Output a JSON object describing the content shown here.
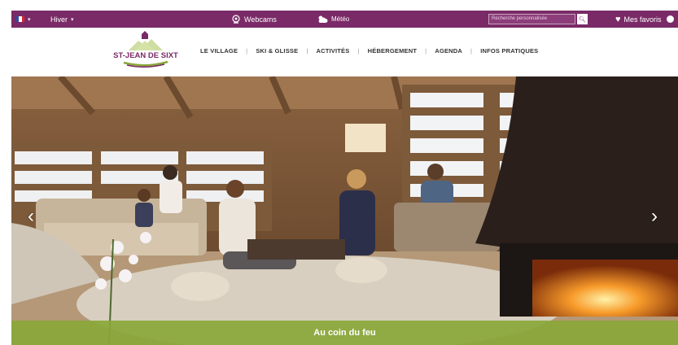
{
  "topbar": {
    "language_icon": "france-flag-icon",
    "season": "Hiver",
    "webcams_label": "Webcams",
    "weather_label": "Météo",
    "search": {
      "placeholder": "Recherche personnalisée"
    },
    "favorites_label": "Mes favoris"
  },
  "logo": {
    "text": "ST-JEAN DE SIXT"
  },
  "nav": {
    "items": [
      {
        "label": "LE VILLAGE"
      },
      {
        "label": "SKI & GLISSE"
      },
      {
        "label": "ACTIVITÉS"
      },
      {
        "label": "HÉBERGEMENT"
      },
      {
        "label": "AGENDA"
      },
      {
        "label": "INFOS PRATIQUES"
      }
    ]
  },
  "hero": {
    "caption": "Au coin du feu"
  },
  "colors": {
    "topbar": "#7a2a67",
    "caption_bar": "#8aa73a"
  }
}
